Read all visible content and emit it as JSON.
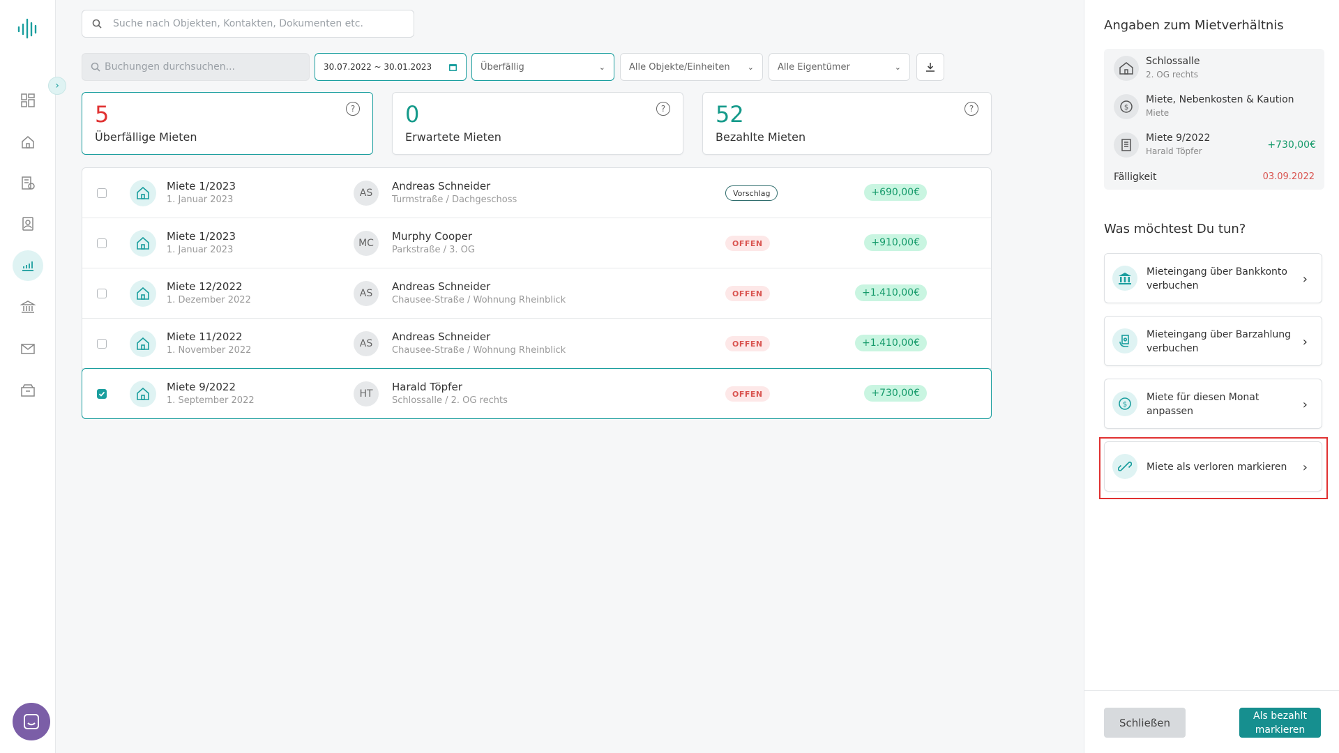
{
  "search": {
    "placeholder": "Suche nach Objekten, Kontakten, Dokumenten etc."
  },
  "filters": {
    "booking_search_placeholder": "Buchungen durchsuchen...",
    "date_range": "30.07.2022 ~ 30.01.2023",
    "status": "Überfällig",
    "objects": "Alle Objekte/Einheiten",
    "owners": "Alle Eigentümer"
  },
  "stats": [
    {
      "value": "5",
      "label": "Überfällige Mieten",
      "color": "#e03131"
    },
    {
      "value": "0",
      "label": "Erwartete Mieten",
      "color": "#159a8a"
    },
    {
      "value": "52",
      "label": "Bezahlte Mieten",
      "color": "#159a8a"
    }
  ],
  "rows": [
    {
      "title": "Miete 1/2023",
      "date": "1. Januar 2023",
      "initials": "AS",
      "tenant": "Andreas Schneider",
      "address": "Turmstraße / Dachgeschoss",
      "badge": "Vorschlag",
      "amount": "+690,00€",
      "checked": false
    },
    {
      "title": "Miete 1/2023",
      "date": "1. Januar 2023",
      "initials": "MC",
      "tenant": "Murphy Cooper",
      "address": "Parkstraße / 3. OG",
      "badge": "OFFEN",
      "amount": "+910,00€",
      "checked": false
    },
    {
      "title": "Miete 12/2022",
      "date": "1. Dezember 2022",
      "initials": "AS",
      "tenant": "Andreas Schneider",
      "address": "Chausee-Straße / Wohnung Rheinblick",
      "badge": "OFFEN",
      "amount": "+1.410,00€",
      "checked": false
    },
    {
      "title": "Miete 11/2022",
      "date": "1. November 2022",
      "initials": "AS",
      "tenant": "Andreas Schneider",
      "address": "Chausee-Straße / Wohnung Rheinblick",
      "badge": "OFFEN",
      "amount": "+1.410,00€",
      "checked": false
    },
    {
      "title": "Miete 9/2022",
      "date": "1. September 2022",
      "initials": "HT",
      "tenant": "Harald Töpfer",
      "address": "Schlossalle / 2. OG rechts",
      "badge": "OFFEN",
      "amount": "+730,00€",
      "checked": true
    }
  ],
  "panel": {
    "title": "Angaben zum Mietverhältnis",
    "property": {
      "name": "Schlossalle",
      "unit": "2. OG rechts"
    },
    "category": {
      "name": "Miete, Nebenkosten & Kaution",
      "sub": "Miete"
    },
    "booking": {
      "name": "Miete 9/2022",
      "tenant": "Harald Töpfer",
      "amount": "+730,00€"
    },
    "due_label": "Fälligkeit",
    "due_date": "03.09.2022",
    "question": "Was möchtest Du tun?",
    "actions": [
      {
        "label": "Mieteingang über Bankkonto verbuchen",
        "icon": "bank-icon"
      },
      {
        "label": "Mieteingang über Barzahlung verbuchen",
        "icon": "cash-icon"
      },
      {
        "label": "Miete für diesen Monat anpassen",
        "icon": "dollar-icon"
      },
      {
        "label": "Miete als verloren markieren",
        "icon": "broken-link-icon"
      }
    ],
    "close_label": "Schließen",
    "paid_label": "Als bezahlt markieren"
  },
  "colors": {
    "accent": "#1a9e9e",
    "danger": "#e03131",
    "success": "#159a6a"
  }
}
